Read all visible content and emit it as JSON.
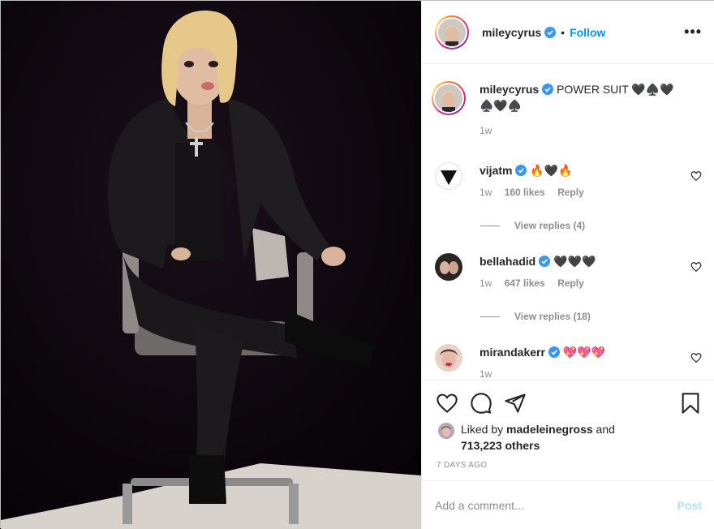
{
  "post": {
    "username": "mileycyrus",
    "follow_label": "Follow",
    "dot": "•",
    "more": "•••"
  },
  "caption": {
    "username": "mileycyrus",
    "text": "POWER SUIT 🖤♠️🖤♠️🖤♠️",
    "time": "1w"
  },
  "comments": [
    {
      "username": "vijatm",
      "text": "🔥🖤🔥",
      "time": "1w",
      "likes": "160 likes",
      "reply": "Reply",
      "view_replies": "View replies (4)"
    },
    {
      "username": "bellahadid",
      "text": "🖤🖤🖤",
      "time": "1w",
      "likes": "647 likes",
      "reply": "Reply",
      "view_replies": "View replies (18)"
    },
    {
      "username": "mirandakerr",
      "text": "💖💖💖",
      "time": "1w",
      "likes": "",
      "reply": ""
    }
  ],
  "likes": {
    "prefix": "Liked by",
    "user": "madeleinegross",
    "and": "and",
    "others": "713,223 others"
  },
  "date": "7 DAYS AGO",
  "add_comment": {
    "placeholder": "Add a comment...",
    "post_label": "Post"
  },
  "colors": {
    "follow": "#0095f6",
    "verified": "#3897f0",
    "post_disabled": "#b2dffc"
  },
  "icons": [
    "like-icon",
    "comment-icon",
    "share-icon",
    "save-icon",
    "verified-icon",
    "more-icon"
  ]
}
